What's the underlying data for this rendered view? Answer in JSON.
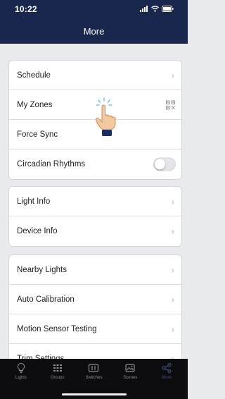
{
  "status_bar": {
    "time": "10:22"
  },
  "header": {
    "title": "More"
  },
  "groups": [
    {
      "items": [
        {
          "label": "Schedule",
          "accessory": "chevron-right-icon"
        },
        {
          "label": "My Zones",
          "accessory": "qr-code-icon"
        },
        {
          "label": "Force Sync",
          "accessory": ""
        },
        {
          "label": "Circadian Rhythms",
          "accessory": "toggle",
          "toggle_on": false
        }
      ]
    },
    {
      "items": [
        {
          "label": "Light Info",
          "accessory": "chevron-right-icon"
        },
        {
          "label": "Device Info",
          "accessory": "chevron-right-icon"
        }
      ]
    },
    {
      "items": [
        {
          "label": "Nearby Lights",
          "accessory": "chevron-right-icon"
        },
        {
          "label": "Auto Calibration",
          "accessory": "chevron-right-icon"
        },
        {
          "label": "Motion Sensor Testing",
          "accessory": "chevron-right-icon"
        },
        {
          "label": "Trim Settings",
          "accessory": "chevron-right-icon"
        }
      ]
    }
  ],
  "tabbar": {
    "tabs": [
      {
        "label": "Lights",
        "icon": "lightbulb-icon",
        "active": false
      },
      {
        "label": "Groups",
        "icon": "groups-icon",
        "active": false
      },
      {
        "label": "Switches",
        "icon": "switches-icon",
        "active": false
      },
      {
        "label": "Scenes",
        "icon": "scenes-icon",
        "active": false
      },
      {
        "label": "More",
        "icon": "share-nodes-icon",
        "active": true
      }
    ]
  },
  "colors": {
    "header_bg": "#19264d",
    "page_bg": "#e9eaee",
    "tabbar_bg": "#0d0d0f",
    "active_tab": "#3f4f7a"
  }
}
